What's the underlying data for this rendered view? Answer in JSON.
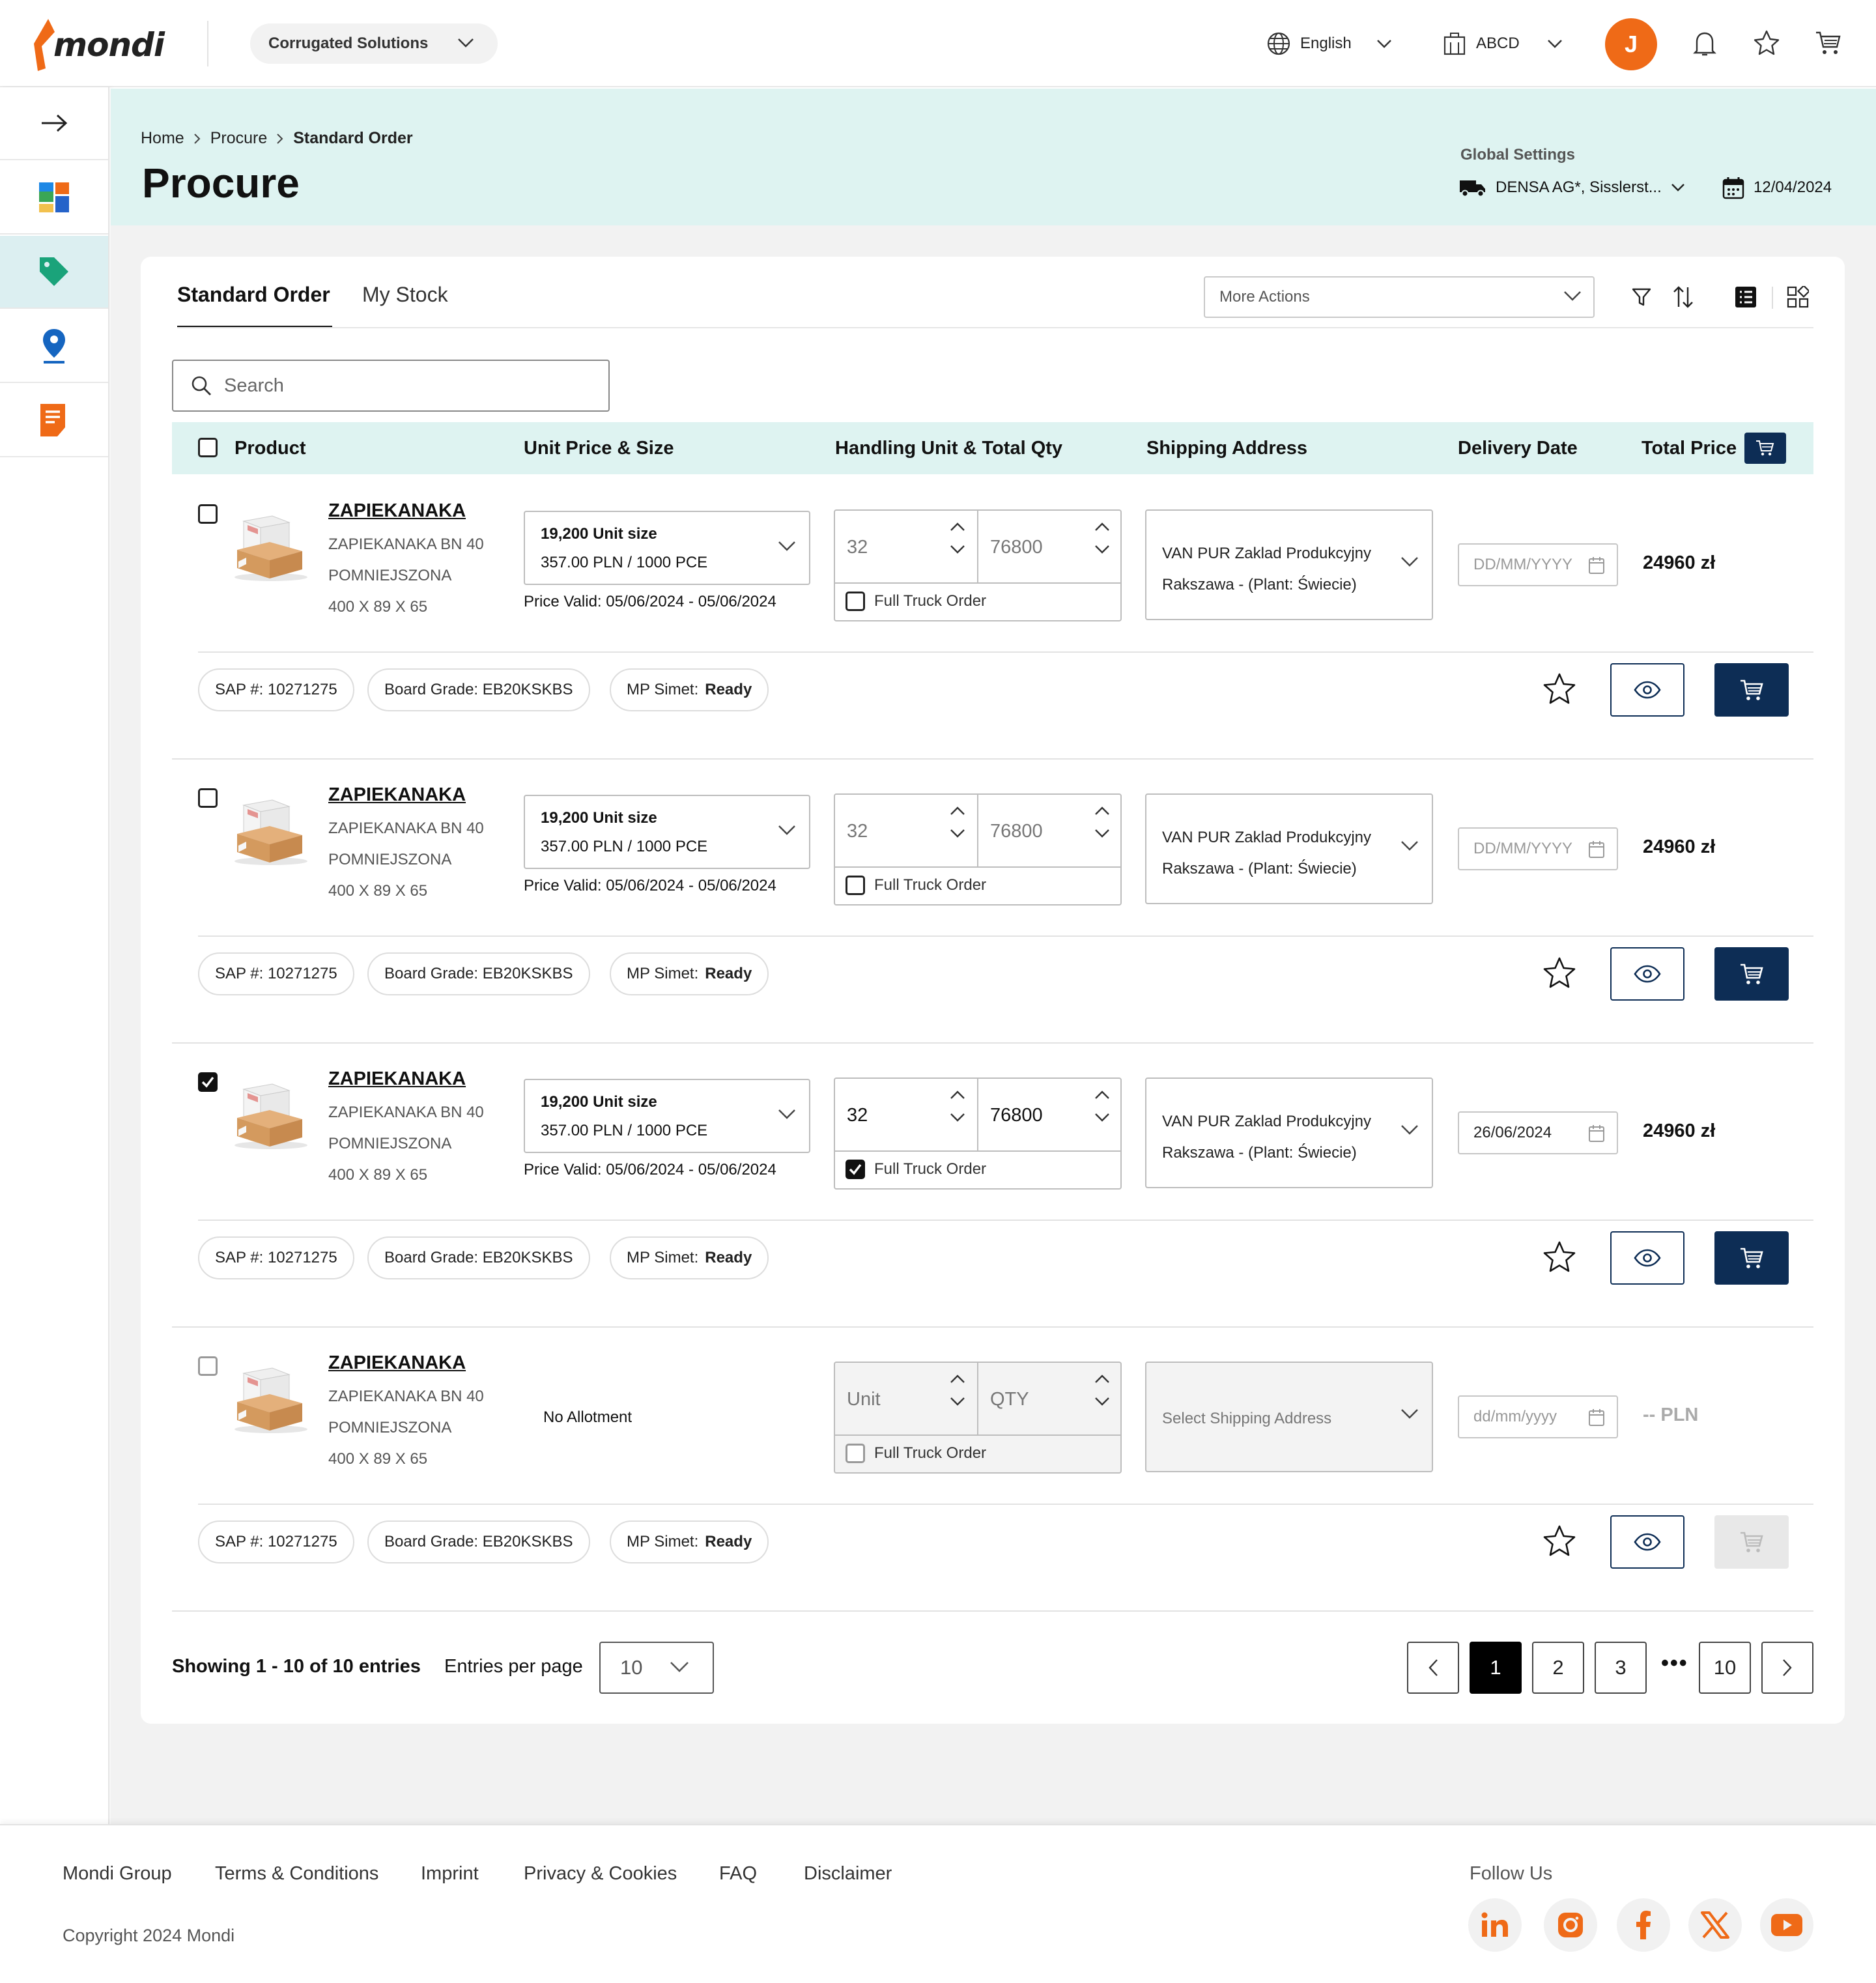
{
  "header": {
    "brand": "mondi",
    "business_unit": "Corrugated Solutions",
    "language": "English",
    "company": "ABCD",
    "avatar_initial": "J"
  },
  "sidebar": {
    "items": [
      {
        "name": "expand",
        "icon": "arrow-right-icon"
      },
      {
        "name": "dashboard",
        "icon": "dashboard-icon"
      },
      {
        "name": "procure",
        "icon": "tag-icon",
        "active": true
      },
      {
        "name": "locations",
        "icon": "map-pin-icon"
      },
      {
        "name": "documents",
        "icon": "document-icon"
      }
    ]
  },
  "breadcrumb": {
    "home": "Home",
    "procure": "Procure",
    "current": "Standard Order"
  },
  "page_title": "Procure",
  "global_settings": {
    "label": "Global Settings",
    "address": "DENSA AG*, Sisslerst...",
    "date": "12/04/2024"
  },
  "tabs": {
    "standard": "Standard Order",
    "stock": "My Stock"
  },
  "toolbar": {
    "more_actions": "More Actions"
  },
  "search": {
    "placeholder": "Search"
  },
  "table": {
    "headers": {
      "product": "Product",
      "unit_price": "Unit Price & Size",
      "handling": "Handling Unit & Total Qty",
      "shipping": "Shipping Address",
      "delivery": "Delivery Date",
      "total": "Total Price"
    },
    "rows": [
      {
        "checked": false,
        "name": "ZAPIEKANAKA",
        "line1": "ZAPIEKANAKA BN 40",
        "line2": "POMNIEJSZONA",
        "dims": "400 X 89 X 65",
        "price_size": "19,200 Unit size",
        "price": "357.00 PLN / 1000 PCE",
        "validity": "Price Valid: 05/06/2024 - 05/06/2024",
        "handling_unit": "32",
        "total_qty": "76800",
        "full_truck_label": "Full Truck Order",
        "full_truck": false,
        "ship_line1": "VAN PUR Zaklad Produkcyjny",
        "ship_line2": "Rakszawa - (Plant: Świecie)",
        "date": "DD/MM/YYYY",
        "total": "24960  zł",
        "sap": "SAP #: 10271275",
        "board": "Board Grade: EB20KSKBS",
        "mp_label": "MP Simet:",
        "mp_value": "Ready"
      },
      {
        "checked": false,
        "name": "ZAPIEKANAKA",
        "line1": "ZAPIEKANAKA BN 40",
        "line2": "POMNIEJSZONA",
        "dims": "400 X 89 X 65",
        "price_size": "19,200 Unit size",
        "price": "357.00 PLN / 1000 PCE",
        "validity": "Price Valid: 05/06/2024 - 05/06/2024",
        "handling_unit": "32",
        "total_qty": "76800",
        "full_truck_label": "Full Truck Order",
        "full_truck": false,
        "ship_line1": "VAN PUR Zaklad Produkcyjny",
        "ship_line2": "Rakszawa - (Plant: Świecie)",
        "date": "DD/MM/YYYY",
        "total": "24960  zł",
        "sap": "SAP #: 10271275",
        "board": "Board Grade: EB20KSKBS",
        "mp_label": "MP Simet:",
        "mp_value": "Ready"
      },
      {
        "checked": true,
        "name": "ZAPIEKANAKA",
        "line1": "ZAPIEKANAKA BN 40",
        "line2": "POMNIEJSZONA",
        "dims": "400 X 89 X 65",
        "price_size": "19,200 Unit size",
        "price": "357.00 PLN / 1000 PCE",
        "validity": "Price Valid: 05/06/2024 - 05/06/2024",
        "handling_unit": "32",
        "total_qty": "76800",
        "full_truck_label": "Full Truck Order",
        "full_truck": true,
        "ship_line1": "VAN PUR Zaklad Produkcyjny",
        "ship_line2": "Rakszawa - (Plant: Świecie)",
        "date": "26/06/2024",
        "total": "24960  zł",
        "sap": "SAP #: 10271275",
        "board": "Board Grade: EB20KSKBS",
        "mp_label": "MP Simet:",
        "mp_value": "Ready"
      },
      {
        "checked": false,
        "name": "ZAPIEKANAKA",
        "line1": "ZAPIEKANAKA BN 40",
        "line2": "POMNIEJSZONA",
        "dims": "400 X 89 X 65",
        "no_allotment": "No Allotment",
        "handling_unit": "Unit",
        "total_qty": "QTY",
        "full_truck_label": "Full Truck Order",
        "full_truck": false,
        "ship_placeholder": "Select Shipping Address",
        "date": "dd/mm/yyyy",
        "total": "-- PLN",
        "sap": "SAP #: 10271275",
        "board": "Board Grade: EB20KSKBS",
        "mp_label": "MP Simet:",
        "mp_value": "Ready"
      }
    ]
  },
  "pagination": {
    "showing": "Showing 1 - 10 of 10 entries",
    "entries_label": "Entries per page",
    "entries_value": "10",
    "pages": [
      "1",
      "2",
      "3",
      "10"
    ],
    "current": "1",
    "ellipsis": "•••"
  },
  "footer": {
    "links": [
      "Mondi Group",
      "Terms & Conditions",
      "Imprint",
      "Privacy & Cookies",
      "FAQ",
      "Disclaimer"
    ],
    "copyright": "Copyright 2024 Mondi",
    "follow": "Follow Us",
    "social": [
      "linkedin-icon",
      "instagram-icon",
      "facebook-icon",
      "x-icon",
      "youtube-icon"
    ]
  },
  "colors": {
    "brand_orange": "#ef6a17",
    "navy": "#0d2d55",
    "mint": "#def3f1"
  }
}
